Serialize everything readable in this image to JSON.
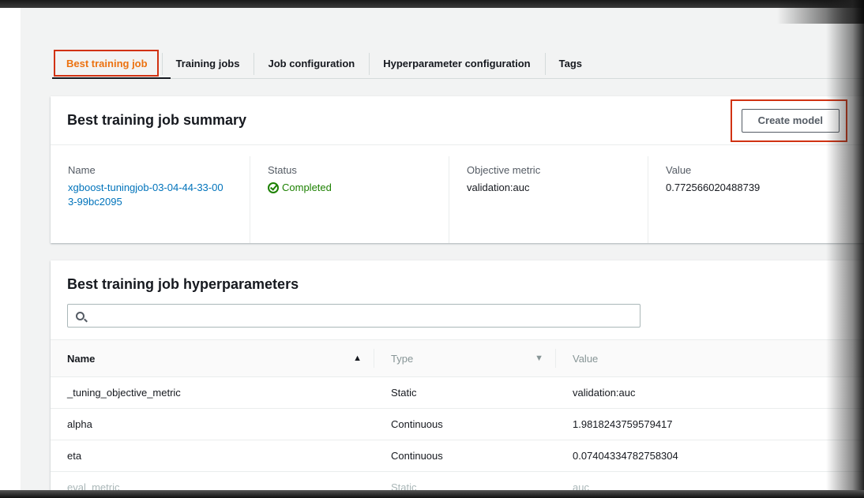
{
  "tabs": [
    {
      "label": "Best training job",
      "active": true
    },
    {
      "label": "Training jobs"
    },
    {
      "label": "Job configuration"
    },
    {
      "label": "Hyperparameter configuration"
    },
    {
      "label": "Tags"
    }
  ],
  "summary": {
    "title": "Best training job summary",
    "create_model_label": "Create model",
    "name_label": "Name",
    "name_value": "xgboost-tuningjob-03-04-44-33-003-99bc2095",
    "status_label": "Status",
    "status_value": "Completed",
    "metric_label": "Objective metric",
    "metric_value": "validation:auc",
    "value_label": "Value",
    "value_value": "0.772566020488739"
  },
  "hyperparameters": {
    "title": "Best training job hyperparameters",
    "search_placeholder": "",
    "columns": [
      "Name",
      "Type",
      "Value"
    ],
    "rows": [
      {
        "name": "_tuning_objective_metric",
        "type": "Static",
        "value": "validation:auc"
      },
      {
        "name": "alpha",
        "type": "Continuous",
        "value": "1.9818243759579417"
      },
      {
        "name": "eta",
        "type": "Continuous",
        "value": "0.07404334782758304"
      },
      {
        "name": "eval_metric",
        "type": "Static",
        "value": "auc"
      }
    ]
  },
  "colors": {
    "accent": "#ec7211",
    "highlight": "#d13212",
    "link": "#0073bb",
    "success": "#1d8102"
  }
}
